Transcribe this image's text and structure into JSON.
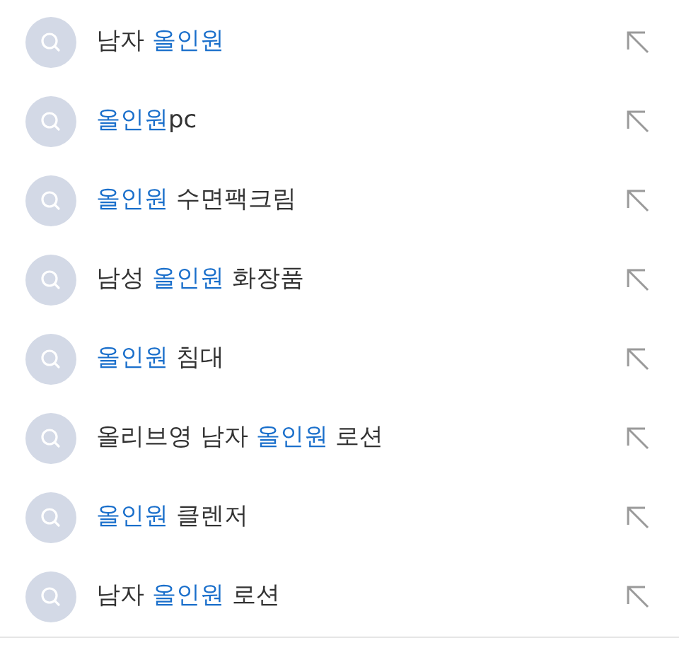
{
  "suggestions": [
    {
      "segments": [
        {
          "text": "남자 ",
          "highlight": false
        },
        {
          "text": "올인원",
          "highlight": true
        }
      ]
    },
    {
      "segments": [
        {
          "text": "올인원",
          "highlight": true
        },
        {
          "text": "pc",
          "highlight": false
        }
      ]
    },
    {
      "segments": [
        {
          "text": "올인원",
          "highlight": true
        },
        {
          "text": " 수면팩크림",
          "highlight": false
        }
      ]
    },
    {
      "segments": [
        {
          "text": "남성 ",
          "highlight": false
        },
        {
          "text": "올인원",
          "highlight": true
        },
        {
          "text": " 화장품",
          "highlight": false
        }
      ]
    },
    {
      "segments": [
        {
          "text": "올인원",
          "highlight": true
        },
        {
          "text": " 침대",
          "highlight": false
        }
      ]
    },
    {
      "segments": [
        {
          "text": "올리브영 남자 ",
          "highlight": false
        },
        {
          "text": "올인원",
          "highlight": true
        },
        {
          "text": " 로션",
          "highlight": false
        }
      ]
    },
    {
      "segments": [
        {
          "text": "올인원",
          "highlight": true
        },
        {
          "text": " 클렌저",
          "highlight": false
        }
      ]
    },
    {
      "segments": [
        {
          "text": "남자 ",
          "highlight": false
        },
        {
          "text": "올인원",
          "highlight": true
        },
        {
          "text": " 로션",
          "highlight": false
        }
      ]
    }
  ]
}
